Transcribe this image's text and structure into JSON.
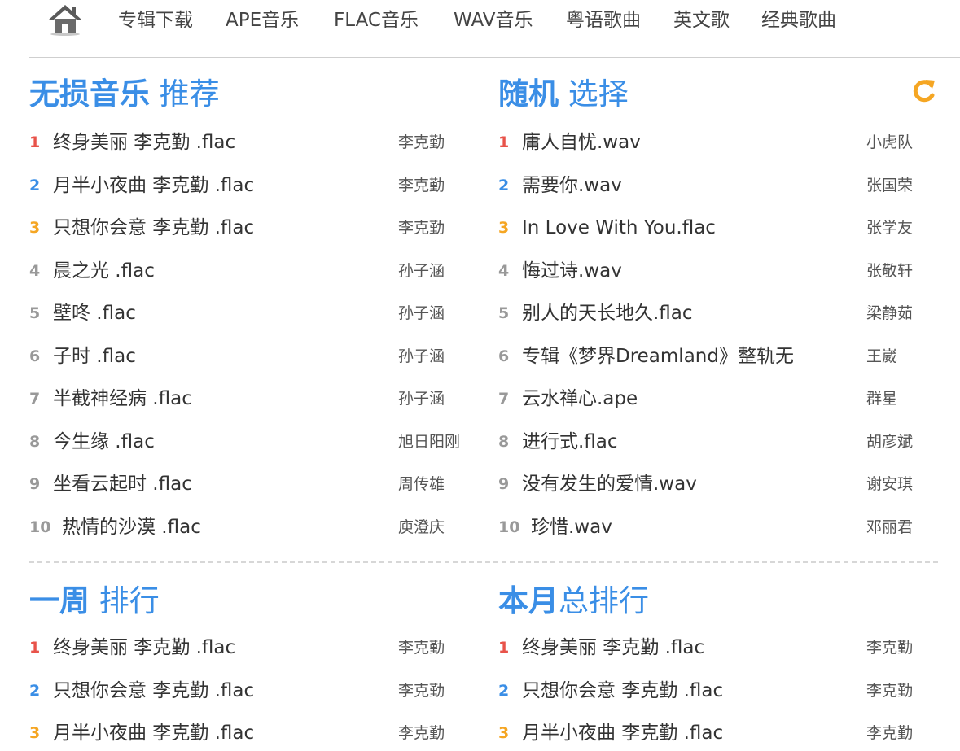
{
  "nav": {
    "home_icon": "home-icon",
    "items": [
      "专辑下载",
      "APE音乐",
      "FLAC音乐",
      "WAV音乐",
      "粤语歌曲",
      "英文歌",
      "经典歌曲"
    ]
  },
  "colors": {
    "accent": "#3a8ee6",
    "rank1": "#e8534a",
    "rank2": "#3a8ee6",
    "rank3": "#f5a623",
    "rankOther": "#999999",
    "refresh": "#f5a623"
  },
  "sections": {
    "lossless": {
      "title_strong": "无损音乐",
      "title_light": "推荐",
      "items": [
        {
          "rank": "1",
          "title": "终身美丽 李克勤 .flac",
          "artist": "李克勤"
        },
        {
          "rank": "2",
          "title": "月半小夜曲 李克勤 .flac",
          "artist": "李克勤"
        },
        {
          "rank": "3",
          "title": "只想你会意 李克勤 .flac",
          "artist": "李克勤"
        },
        {
          "rank": "4",
          "title": "晨之光 .flac",
          "artist": "孙子涵"
        },
        {
          "rank": "5",
          "title": "壁咚 .flac",
          "artist": "孙子涵"
        },
        {
          "rank": "6",
          "title": "子时 .flac",
          "artist": "孙子涵"
        },
        {
          "rank": "7",
          "title": "半截神经病 .flac",
          "artist": "孙子涵"
        },
        {
          "rank": "8",
          "title": "今生缘 .flac",
          "artist": "旭日阳刚"
        },
        {
          "rank": "9",
          "title": "坐看云起时 .flac",
          "artist": "周传雄"
        },
        {
          "rank": "10",
          "title": "热情的沙漠 .flac",
          "artist": "庾澄庆"
        }
      ]
    },
    "random": {
      "title_strong": "随机",
      "title_light": "选择",
      "refresh_icon": "refresh-icon",
      "items": [
        {
          "rank": "1",
          "title": "庸人自忧.wav",
          "artist": "小虎队"
        },
        {
          "rank": "2",
          "title": "需要你.wav",
          "artist": "张国荣"
        },
        {
          "rank": "3",
          "title": "In Love With You.flac",
          "artist": "张学友"
        },
        {
          "rank": "4",
          "title": "悔过诗.wav",
          "artist": "张敬轩"
        },
        {
          "rank": "5",
          "title": "别人的天长地久.flac",
          "artist": "梁静茹"
        },
        {
          "rank": "6",
          "title": "专辑《梦界Dreamland》整轨无",
          "artist": "王崴"
        },
        {
          "rank": "7",
          "title": "云水禅心.ape",
          "artist": "群星"
        },
        {
          "rank": "8",
          "title": "进行式.flac",
          "artist": "胡彦斌"
        },
        {
          "rank": "9",
          "title": "没有发生的爱情.wav",
          "artist": "谢安琪"
        },
        {
          "rank": "10",
          "title": "珍惜.wav",
          "artist": "邓丽君"
        }
      ]
    },
    "week": {
      "title_strong": "一周",
      "title_light": "排行",
      "items": [
        {
          "rank": "1",
          "title": "终身美丽 李克勤 .flac",
          "artist": "李克勤"
        },
        {
          "rank": "2",
          "title": "只想你会意 李克勤 .flac",
          "artist": "李克勤"
        },
        {
          "rank": "3",
          "title": "月半小夜曲 李克勤 .flac",
          "artist": "李克勤"
        }
      ]
    },
    "month": {
      "title_strong": "本月",
      "title_light": "总排行",
      "items": [
        {
          "rank": "1",
          "title": "终身美丽 李克勤 .flac",
          "artist": "李克勤"
        },
        {
          "rank": "2",
          "title": "只想你会意 李克勤 .flac",
          "artist": "李克勤"
        },
        {
          "rank": "3",
          "title": "月半小夜曲 李克勤 .flac",
          "artist": "李克勤"
        }
      ]
    }
  }
}
